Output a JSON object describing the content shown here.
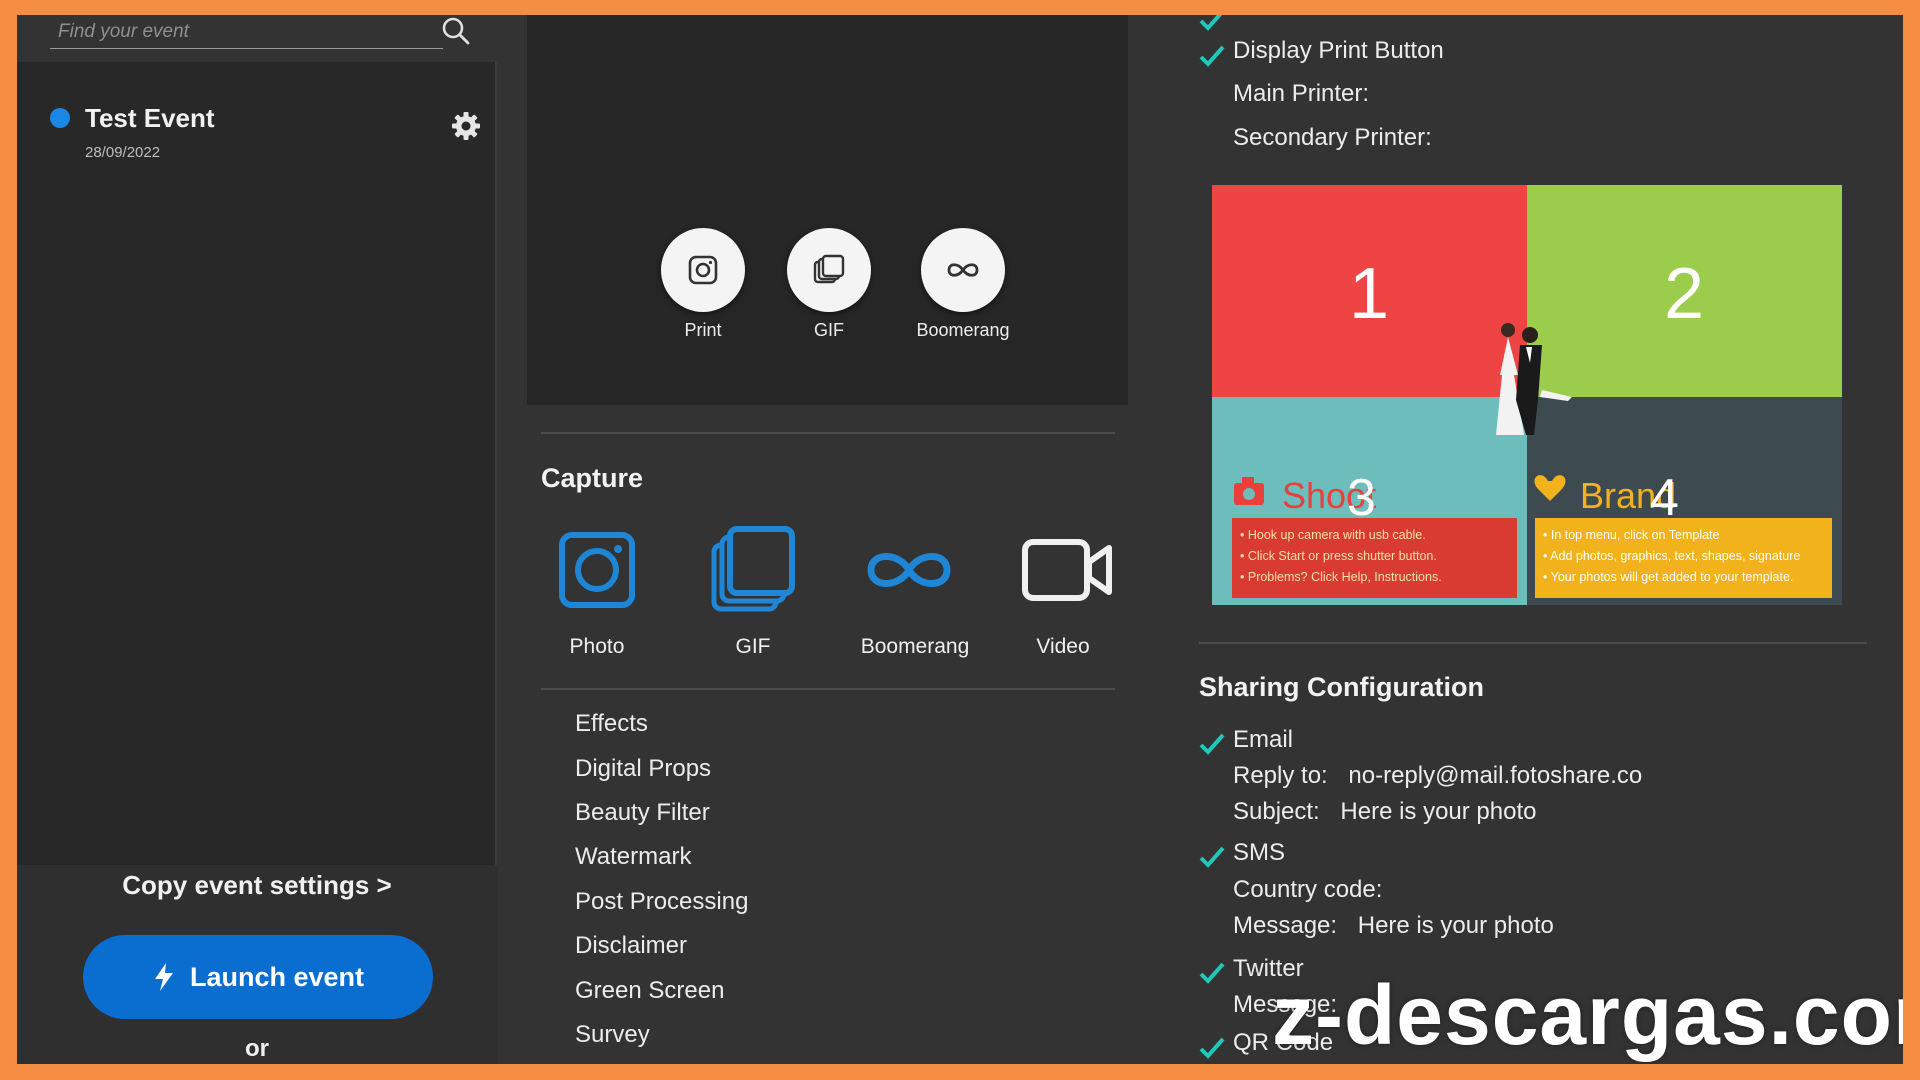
{
  "search": {
    "placeholder": "Find your event"
  },
  "event": {
    "name": "Test Event",
    "date": "28/09/2022"
  },
  "sidebar": {
    "copy_settings": "Copy event settings >",
    "launch_label": "Launch event",
    "or": "or"
  },
  "preview_buttons": [
    "Print",
    "GIF",
    "Boomerang"
  ],
  "capture": {
    "title": "Capture",
    "modes": [
      "Photo",
      "GIF",
      "Boomerang",
      "Video"
    ]
  },
  "menu": [
    "Effects",
    "Digital Props",
    "Beauty Filter",
    "Watermark",
    "Post Processing",
    "Disclaimer",
    "Green Screen",
    "Survey"
  ],
  "print_config": {
    "display_print_button": "Display Print Button",
    "main_printer": "Main Printer:",
    "secondary_printer": "Secondary Printer:"
  },
  "template": {
    "numbers": [
      "1",
      "2",
      "3",
      "4"
    ],
    "shoot_title": "Shoot",
    "brand_title": "Brand",
    "shoot_bullets": [
      "Hook up camera with usb cable.",
      "Click Start or press shutter button.",
      "Problems? Click Help, Instructions."
    ],
    "brand_bullets": [
      "In top menu, click on Template",
      "Add photos, graphics, text, shapes, signature",
      "Your photos will get added to your template."
    ],
    "colors": {
      "q1": "#ee4444",
      "q2": "#9ccc4b",
      "q3": "#6dbdbd",
      "q4": "#3d4a50",
      "box_red": "#d93b33",
      "box_yellow": "#f2b21b"
    }
  },
  "sharing": {
    "title": "Sharing Configuration",
    "email": "Email",
    "reply_to_label": "Reply to:",
    "reply_to_value": "no-reply@mail.fotoshare.co",
    "subject_label": "Subject:",
    "subject_value": "Here is your photo",
    "sms": "SMS",
    "country_code_label": "Country code:",
    "message_label": "Message:",
    "message_value": "Here is your photo",
    "twitter": "Twitter",
    "twitter_message_label": "Message:",
    "qr_code": "QR Code"
  },
  "watermark_text": "z-descargas.com",
  "colors": {
    "accent_blue": "#0a6ed1",
    "capture_icon_blue": "#1f86d6",
    "check_teal": "#1fc8b8",
    "border_orange": "#f58d42"
  }
}
